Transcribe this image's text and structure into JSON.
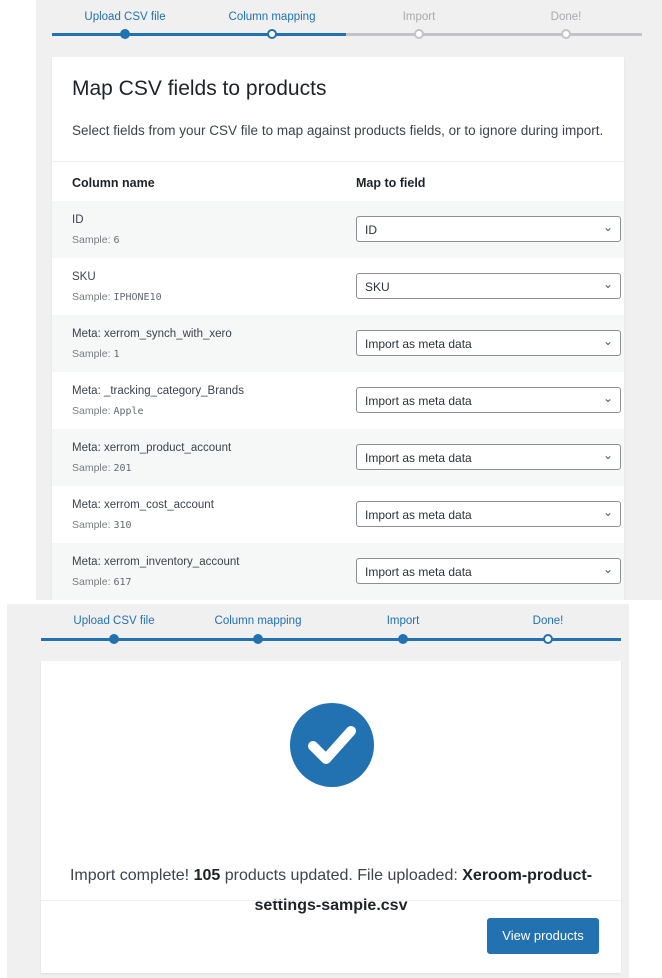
{
  "mapping_screen": {
    "steps": [
      {
        "label": "Upload CSV file",
        "state": "done"
      },
      {
        "label": "Column mapping",
        "state": "active"
      },
      {
        "label": "Import",
        "state": "pending"
      },
      {
        "label": "Done!",
        "state": "pending"
      }
    ],
    "title": "Map CSV fields to products",
    "description": "Select fields from your CSV file to map against products fields, or to ignore during import.",
    "headers": {
      "column_name": "Column name",
      "map_to_field": "Map to field"
    },
    "sample_prefix": "Sample:",
    "rows": [
      {
        "name": "ID",
        "sample": "6",
        "field": "ID"
      },
      {
        "name": "SKU",
        "sample": "IPHONE10",
        "field": "SKU"
      },
      {
        "name": "Meta: xerrom_synch_with_xero",
        "sample": "1",
        "field": "Import as meta data"
      },
      {
        "name": "Meta: _tracking_category_Brands",
        "sample": "Apple",
        "field": "Import as meta data"
      },
      {
        "name": "Meta: xerrom_product_account",
        "sample": "201",
        "field": "Import as meta data"
      },
      {
        "name": "Meta: xerrom_cost_account",
        "sample": "310",
        "field": "Import as meta data"
      },
      {
        "name": "Meta: xerrom_inventory_account",
        "sample": "617",
        "field": "Import as meta data"
      }
    ]
  },
  "done_screen": {
    "steps": [
      {
        "label": "Upload CSV file",
        "state": "done"
      },
      {
        "label": "Column mapping",
        "state": "done"
      },
      {
        "label": "Import",
        "state": "done"
      },
      {
        "label": "Done!",
        "state": "active"
      }
    ],
    "message_start": "Import complete!",
    "updated_count": "105",
    "message_mid": "products updated. File uploaded:",
    "file_name_line1": "Xeroom-product-",
    "file_name_line2": "settings-sample.csv",
    "button_label": "View products"
  },
  "colors": {
    "accent": "#2271b1",
    "pending": "#c3c4c7",
    "background": "#f0f0f1"
  }
}
